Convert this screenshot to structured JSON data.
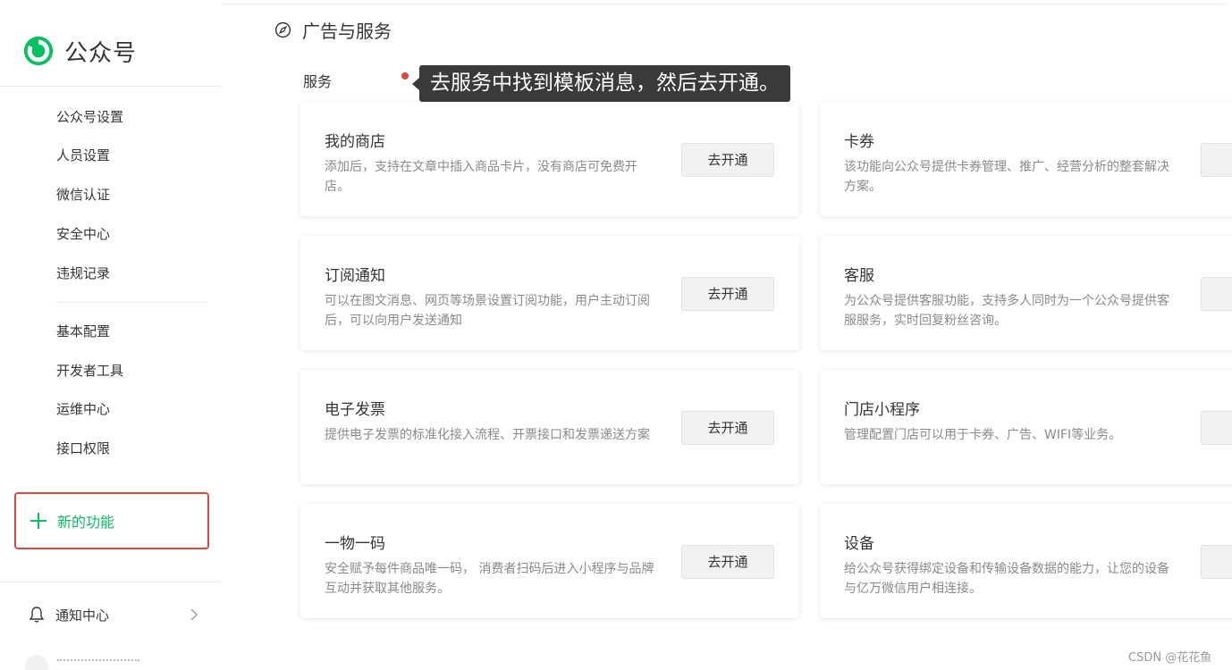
{
  "sidebar": {
    "logo_text": "公众号",
    "group1": [
      "公众号设置",
      "人员设置",
      "微信认证",
      "安全中心",
      "违规记录"
    ],
    "group2": [
      "基本配置",
      "开发者工具",
      "运维中心",
      "接口权限"
    ],
    "new_feature_label": "新的功能",
    "notice_label": "通知中心"
  },
  "main": {
    "title": "广告与服务",
    "section_label": "服务",
    "tooltip": "去服务中找到模板消息，然后去开通。",
    "cards": [
      {
        "title": "我的商店",
        "desc": "添加后，支持在文章中插入商品卡片，没有商店可免费开店。",
        "button": "去开通"
      },
      {
        "title": "卡券",
        "desc": "该功能向公众号提供卡券管理、推广、经营分析的整套解决方案。",
        "button": ""
      },
      {
        "title": "订阅通知",
        "desc": "可以在图文消息、网页等场景设置订阅功能，用户主动订阅后，可以向用户发送通知",
        "button": "去开通"
      },
      {
        "title": "客服",
        "desc": "为公众号提供客服功能，支持多人同时为一个公众号提供客服服务，实时回复粉丝咨询。",
        "button": ""
      },
      {
        "title": "电子发票",
        "desc": "提供电子发票的标准化接入流程、开票接口和发票递送方案",
        "button": "去开通"
      },
      {
        "title": "门店小程序",
        "desc": "管理配置门店可以用于卡券、广告、WIFI等业务。",
        "button": ""
      },
      {
        "title": "一物一码",
        "desc": "安全赋予每件商品唯一码， 消费者扫码后进入小程序与品牌互动并获取其他服务。",
        "button": "去开通"
      },
      {
        "title": "设备",
        "desc": "给公众号获得绑定设备和传输设备数据的能力，让您的设备与亿万微信用户相连接。",
        "button": ""
      }
    ]
  },
  "watermark": "CSDN @花花鱼",
  "colors": {
    "accent": "#07c160",
    "highlight_border": "#e0483b",
    "tooltip_bg": "#3a3a3a"
  }
}
